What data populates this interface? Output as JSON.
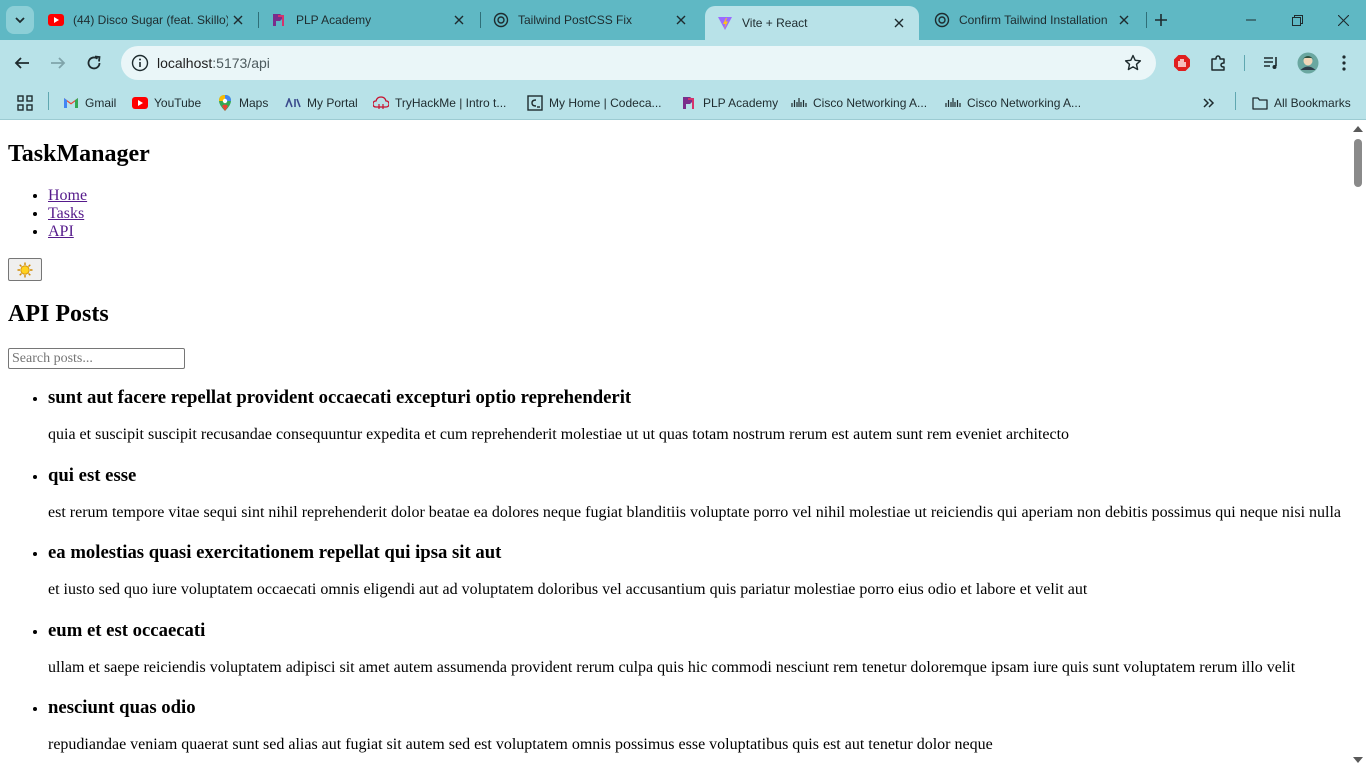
{
  "browser": {
    "tabs": [
      {
        "title": "(44) Disco Sugar (feat. Skillo)",
        "favicon": "youtube-icon",
        "active": false
      },
      {
        "title": "PLP Academy",
        "favicon": "plp-icon",
        "active": false
      },
      {
        "title": "Tailwind PostCSS Fix",
        "favicon": "chatgpt-icon",
        "active": false
      },
      {
        "title": "Vite + React",
        "favicon": "vite-icon",
        "active": true
      },
      {
        "title": "Confirm Tailwind Installation",
        "favicon": "chatgpt-icon",
        "active": false
      }
    ],
    "address": {
      "host": "localhost",
      "path": ":5173/api"
    },
    "bookmarks": [
      {
        "label": "Gmail",
        "icon": "gmail-icon"
      },
      {
        "label": "YouTube",
        "icon": "youtube-icon"
      },
      {
        "label": "Maps",
        "icon": "maps-icon"
      },
      {
        "label": "My Portal",
        "icon": "portal-icon"
      },
      {
        "label": "TryHackMe | Intro t...",
        "icon": "tryhackme-icon"
      },
      {
        "label": "My Home | Codeca...",
        "icon": "codecademy-icon"
      },
      {
        "label": "PLP Academy",
        "icon": "plp-icon"
      },
      {
        "label": "Cisco Networking A...",
        "icon": "cisco-icon"
      },
      {
        "label": "Cisco Networking A...",
        "icon": "cisco-icon"
      }
    ],
    "all_bookmarks": "All Bookmarks",
    "colors": {
      "frame": "#5fb8c4",
      "toolbar": "#b8e2e8",
      "omnibox": "#eaf6f8"
    }
  },
  "app": {
    "brand": "TaskManager",
    "nav": [
      "Home",
      "Tasks",
      "API"
    ],
    "theme_toggle_icon": "sun-icon",
    "heading": "API Posts",
    "search_placeholder": "Search posts...",
    "posts": [
      {
        "title": "sunt aut facere repellat provident occaecati excepturi optio reprehenderit",
        "body": "quia et suscipit suscipit recusandae consequuntur expedita et cum reprehenderit molestiae ut ut quas totam nostrum rerum est autem sunt rem eveniet architecto"
      },
      {
        "title": "qui est esse",
        "body": "est rerum tempore vitae sequi sint nihil reprehenderit dolor beatae ea dolores neque fugiat blanditiis voluptate porro vel nihil molestiae ut reiciendis qui aperiam non debitis possimus qui neque nisi nulla"
      },
      {
        "title": "ea molestias quasi exercitationem repellat qui ipsa sit aut",
        "body": "et iusto sed quo iure voluptatem occaecati omnis eligendi aut ad voluptatem doloribus vel accusantium quis pariatur molestiae porro eius odio et labore et velit aut"
      },
      {
        "title": "eum et est occaecati",
        "body": "ullam et saepe reiciendis voluptatem adipisci sit amet autem assumenda provident rerum culpa quis hic commodi nesciunt rem tenetur doloremque ipsam iure quis sunt voluptatem rerum illo velit"
      },
      {
        "title": "nesciunt quas odio",
        "body": "repudiandae veniam quaerat sunt sed alias aut fugiat sit autem sed est voluptatem omnis possimus esse voluptatibus quis est aut tenetur dolor neque"
      }
    ]
  }
}
